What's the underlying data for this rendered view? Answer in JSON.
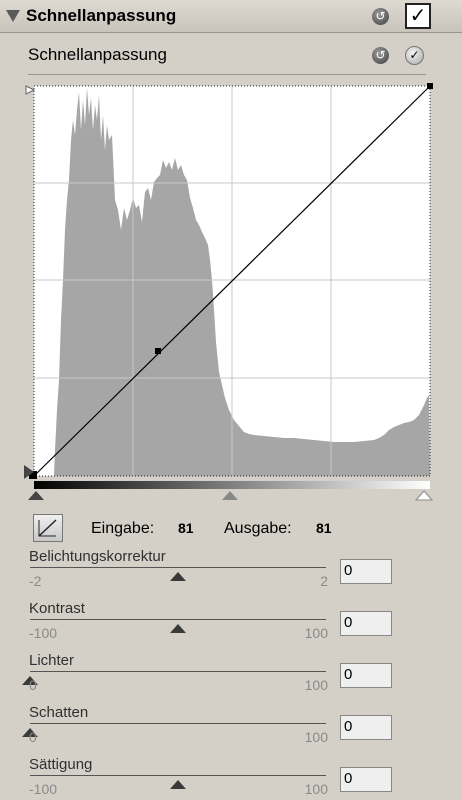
{
  "panel": {
    "title": "Schnellanpassung",
    "subtitle": "Schnellanpassung",
    "reset_symbol": "↺",
    "check_symbol": "✓",
    "enabled": true
  },
  "curve": {
    "eingabe_label": "Eingabe:",
    "eingabe_value": "81",
    "ausgabe_label": "Ausgabe:",
    "ausgabe_value": "81"
  },
  "sliders": [
    {
      "label": "Belichtungskorrektur",
      "min": "-2",
      "max": "2",
      "value": "0",
      "level": 0.5
    },
    {
      "label": "Kontrast",
      "min": "-100",
      "max": "100",
      "value": "0",
      "level": 0.5
    },
    {
      "label": "Lichter",
      "min": "0",
      "max": "100",
      "value": "0",
      "level": 0.0
    },
    {
      "label": "Schatten",
      "min": "0",
      "max": "100",
      "value": "0",
      "level": 0.0
    },
    {
      "label": "Sättigung",
      "min": "-100",
      "max": "100",
      "value": "0",
      "level": 0.5
    }
  ]
}
